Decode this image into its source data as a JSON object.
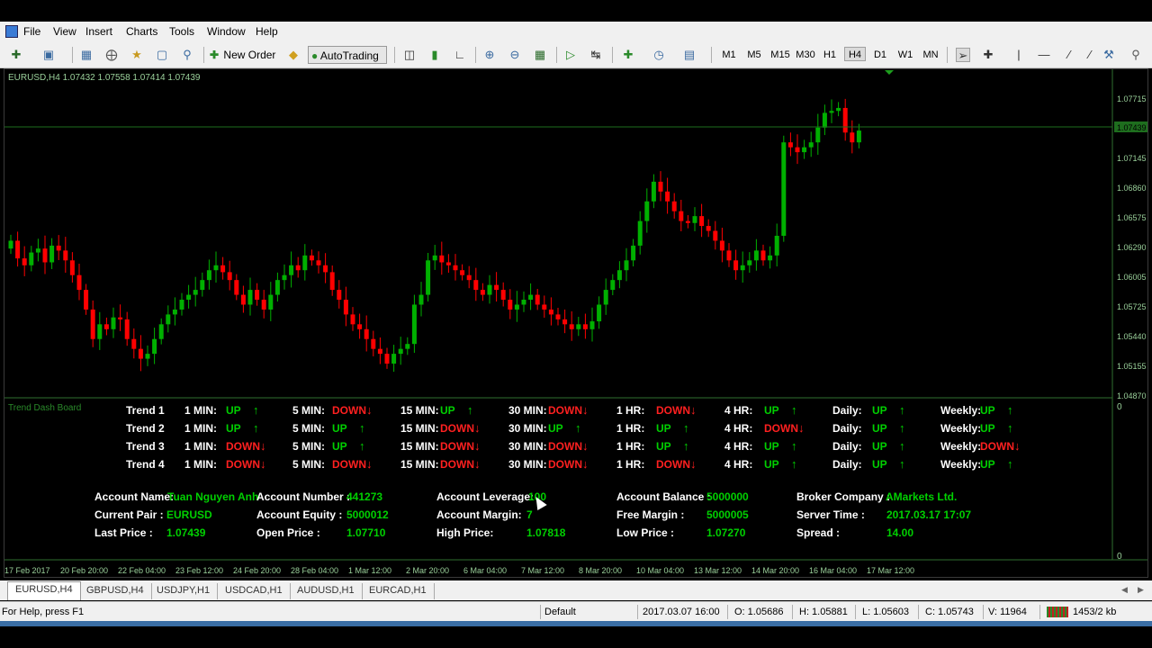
{
  "menu": [
    "File",
    "View",
    "Insert",
    "Charts",
    "Tools",
    "Window",
    "Help"
  ],
  "toolbar": {
    "new_order": "New Order",
    "autotrading": "AutoTrading",
    "timeframes": [
      "M1",
      "M5",
      "M15",
      "M30",
      "H1",
      "H4",
      "D1",
      "W1",
      "MN"
    ],
    "active_timeframe": "H4"
  },
  "chart": {
    "header": "EURUSD,H4  1.07432  1.07558  1.07414  1.07439",
    "current_price": "1.07439",
    "price_labels": [
      "1.07715",
      "1.07439",
      "1.07145",
      "1.06860",
      "1.06575",
      "1.06290",
      "1.06005",
      "1.05725",
      "1.05440",
      "1.05155",
      "1.04870"
    ],
    "ylim": [
      1.0473,
      1.0786
    ],
    "time_labels": [
      "17 Feb 2017",
      "20 Feb 20:00",
      "22 Feb 04:00",
      "23 Feb 12:00",
      "24 Feb 20:00",
      "28 Feb 04:00",
      "1 Mar 12:00",
      "2 Mar 20:00",
      "6 Mar 04:00",
      "7 Mar 12:00",
      "8 Mar 20:00",
      "10 Mar 04:00",
      "13 Mar 12:00",
      "14 Mar 20:00",
      "16 Mar 04:00",
      "17 Mar 12:00"
    ],
    "indicator_window_label": "Trend Dash Board",
    "indicator_zero_label": "0",
    "up_color": "#00b000",
    "down_color": "#ff0000",
    "closes": [
      1.063,
      1.0612,
      1.0605,
      1.0618,
      1.0622,
      1.0608,
      1.0625,
      1.062,
      1.061,
      1.0595,
      1.058,
      1.056,
      1.053,
      1.0545,
      1.054,
      1.0552,
      1.055,
      1.053,
      1.052,
      1.051,
      1.0515,
      1.053,
      1.0545,
      1.0555,
      1.056,
      1.057,
      1.0575,
      1.058,
      1.059,
      1.06,
      1.0605,
      1.0598,
      1.059,
      1.0575,
      1.0565,
      1.058,
      1.057,
      1.056,
      1.0575,
      1.059,
      1.0595,
      1.0605,
      1.06,
      1.0615,
      1.061,
      1.0605,
      1.0598,
      1.058,
      1.057,
      1.0555,
      1.0545,
      1.054,
      1.053,
      1.052,
      1.0515,
      1.0505,
      1.0515,
      1.052,
      1.0525,
      1.0565,
      1.0575,
      1.061,
      1.0615,
      1.0608,
      1.0605,
      1.06,
      1.0595,
      1.059,
      1.058,
      1.0575,
      1.0585,
      1.058,
      1.057,
      1.056,
      1.0565,
      1.057,
      1.0575,
      1.0565,
      1.056,
      1.0555,
      1.055,
      1.0545,
      1.054,
      1.0545,
      1.054,
      1.0548,
      1.0565,
      1.058,
      1.059,
      1.06,
      1.061,
      1.0625,
      1.065,
      1.067,
      1.069,
      1.068,
      1.067,
      1.066,
      1.065,
      1.0648,
      1.0655,
      1.0645,
      1.064,
      1.063,
      1.062,
      1.061,
      1.06,
      1.0605,
      1.061,
      1.062,
      1.061,
      1.0615,
      1.0635,
      1.073,
      1.0725,
      1.072,
      1.0725,
      1.073,
      1.0745,
      1.076,
      1.0762,
      1.0765,
      1.074,
      1.073,
      1.0742
    ]
  },
  "trends": [
    {
      "name": "Trend 1",
      "values": [
        "UP",
        "DOWN",
        "UP",
        "DOWN",
        "DOWN",
        "UP",
        "UP",
        "UP"
      ]
    },
    {
      "name": "Trend 2",
      "values": [
        "UP",
        "UP",
        "DOWN",
        "UP",
        "UP",
        "DOWN",
        "UP",
        "UP"
      ]
    },
    {
      "name": "Trend 3",
      "values": [
        "DOWN",
        "UP",
        "DOWN",
        "DOWN",
        "UP",
        "UP",
        "UP",
        "DOWN"
      ]
    },
    {
      "name": "Trend 4",
      "values": [
        "DOWN",
        "DOWN",
        "DOWN",
        "DOWN",
        "DOWN",
        "UP",
        "UP",
        "UP"
      ]
    }
  ],
  "trend_labels": [
    "1 MIN:",
    "5 MIN:",
    "15 MIN:",
    "30 MIN:",
    "1 HR:",
    "4 HR:",
    "Daily:",
    "Weekly:"
  ],
  "account": {
    "name_label": "Account Name:",
    "name": "Tuan Nguyen Anh",
    "number_label": "Account Number :",
    "number": "441273",
    "leverage_label": "Account Leverage:",
    "leverage": "100",
    "balance_label": "Account Balance :",
    "balance": "5000000",
    "broker_label": "Broker Company :",
    "broker": "AMarkets Ltd.",
    "pair_label": "Current Pair :",
    "pair": "EURUSD",
    "equity_label": "Account Equity :",
    "equity": "5000012",
    "margin_label": "Account Margin:",
    "margin": "7",
    "free_margin_label": "Free Margin :",
    "free_margin": "5000005",
    "server_time_label": "Server Time :",
    "server_time": "2017.03.17 17:07",
    "last_price_label": "Last Price :",
    "last_price": "1.07439",
    "open_price_label": "Open Price :",
    "open_price": "1.07710",
    "high_price_label": "High Price:",
    "high_price": "1.07818",
    "low_price_label": "Low Price :",
    "low_price": "1.07270",
    "spread_label": "Spread :",
    "spread": "14.00"
  },
  "tabs": [
    "EURUSD,H4",
    "GBPUSD,H4",
    "USDJPY,H1",
    "USDCAD,H1",
    "AUDUSD,H1",
    "EURCAD,H1"
  ],
  "status": {
    "help": "For Help, press F1",
    "profile": "Default",
    "datetime": "2017.03.07 16:00",
    "open": "O: 1.05686",
    "high": "H: 1.05881",
    "low": "L: 1.05603",
    "close": "C: 1.05743",
    "volume": "V: 11964",
    "traffic": "1453/2 kb"
  }
}
